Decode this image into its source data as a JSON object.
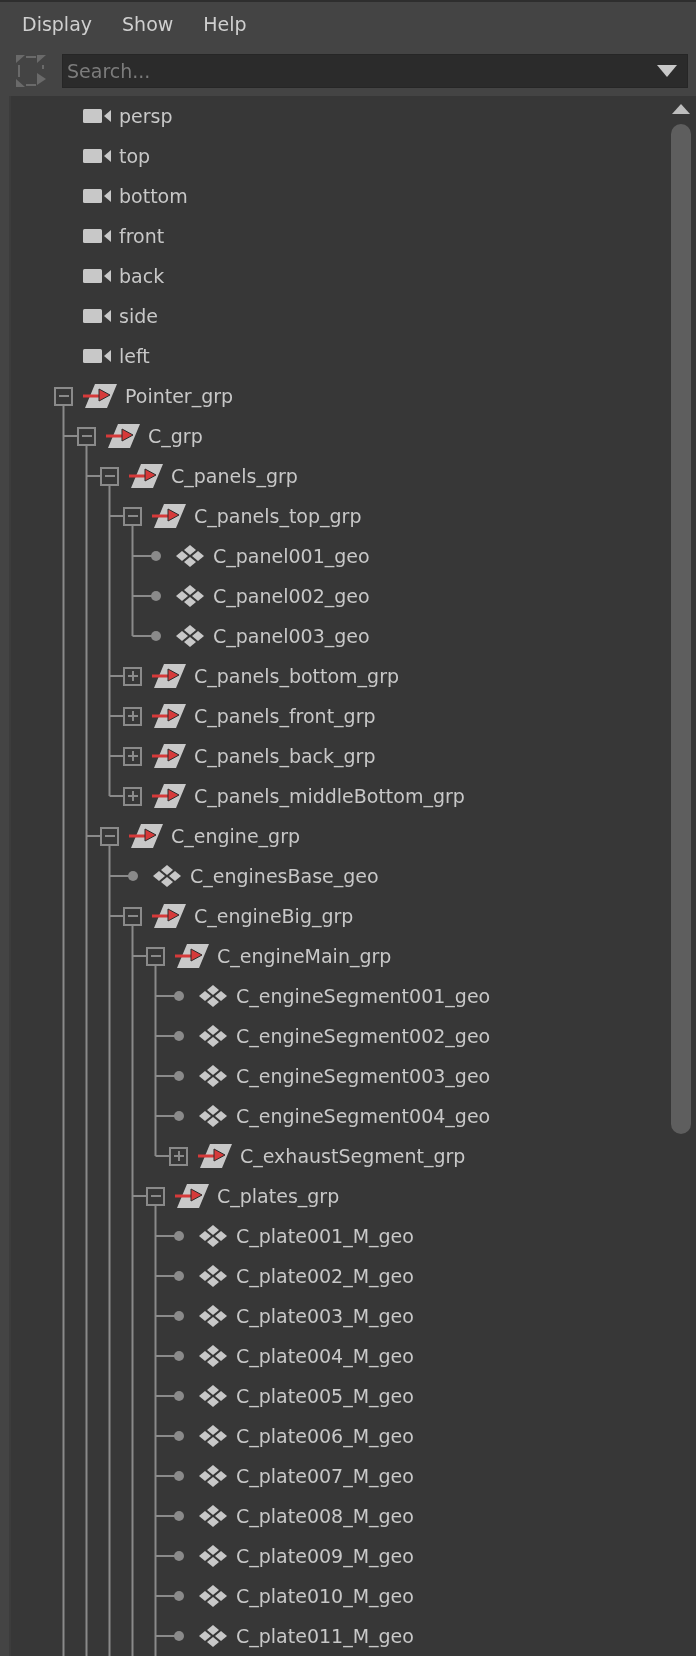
{
  "menu": [
    "Display",
    "Show",
    "Help"
  ],
  "search": {
    "placeholder": "Search..."
  },
  "tree": [
    {
      "label": "persp",
      "kind": "camera"
    },
    {
      "label": "top",
      "kind": "camera"
    },
    {
      "label": "bottom",
      "kind": "camera"
    },
    {
      "label": "front",
      "kind": "camera"
    },
    {
      "label": "back",
      "kind": "camera"
    },
    {
      "label": "side",
      "kind": "camera"
    },
    {
      "label": "left",
      "kind": "camera"
    },
    {
      "label": "Pointer_grp",
      "kind": "group",
      "expanded": true,
      "children": [
        {
          "label": "C_grp",
          "kind": "group",
          "expanded": true,
          "children": [
            {
              "label": "C_panels_grp",
              "kind": "group",
              "expanded": true,
              "children": [
                {
                  "label": "C_panels_top_grp",
                  "kind": "group",
                  "expanded": true,
                  "children": [
                    {
                      "label": "C_panel001_geo",
                      "kind": "mesh"
                    },
                    {
                      "label": "C_panel002_geo",
                      "kind": "mesh"
                    },
                    {
                      "label": "C_panel003_geo",
                      "kind": "mesh"
                    }
                  ]
                },
                {
                  "label": "C_panels_bottom_grp",
                  "kind": "group",
                  "expanded": false
                },
                {
                  "label": "C_panels_front_grp",
                  "kind": "group",
                  "expanded": false
                },
                {
                  "label": "C_panels_back_grp",
                  "kind": "group",
                  "expanded": false
                },
                {
                  "label": "C_panels_middleBottom_grp",
                  "kind": "group",
                  "expanded": false
                }
              ]
            },
            {
              "label": "C_engine_grp",
              "kind": "group",
              "expanded": true,
              "children": [
                {
                  "label": "C_enginesBase_geo",
                  "kind": "mesh"
                },
                {
                  "label": "C_engineBig_grp",
                  "kind": "group",
                  "expanded": true,
                  "children": [
                    {
                      "label": "C_engineMain_grp",
                      "kind": "group",
                      "expanded": true,
                      "children": [
                        {
                          "label": "C_engineSegment001_geo",
                          "kind": "mesh"
                        },
                        {
                          "label": "C_engineSegment002_geo",
                          "kind": "mesh"
                        },
                        {
                          "label": "C_engineSegment003_geo",
                          "kind": "mesh"
                        },
                        {
                          "label": "C_engineSegment004_geo",
                          "kind": "mesh"
                        },
                        {
                          "label": "C_exhaustSegment_grp",
                          "kind": "group",
                          "expanded": false
                        }
                      ]
                    },
                    {
                      "label": "C_plates_grp",
                      "kind": "group",
                      "expanded": true,
                      "children": [
                        {
                          "label": "C_plate001_M_geo",
                          "kind": "mesh"
                        },
                        {
                          "label": "C_plate002_M_geo",
                          "kind": "mesh"
                        },
                        {
                          "label": "C_plate003_M_geo",
                          "kind": "mesh"
                        },
                        {
                          "label": "C_plate004_M_geo",
                          "kind": "mesh"
                        },
                        {
                          "label": "C_plate005_M_geo",
                          "kind": "mesh"
                        },
                        {
                          "label": "C_plate006_M_geo",
                          "kind": "mesh"
                        },
                        {
                          "label": "C_plate007_M_geo",
                          "kind": "mesh"
                        },
                        {
                          "label": "C_plate008_M_geo",
                          "kind": "mesh"
                        },
                        {
                          "label": "C_plate009_M_geo",
                          "kind": "mesh"
                        },
                        {
                          "label": "C_plate010_M_geo",
                          "kind": "mesh"
                        },
                        {
                          "label": "C_plate011_M_geo",
                          "kind": "mesh"
                        }
                      ]
                    }
                  ]
                }
              ]
            }
          ]
        }
      ]
    }
  ]
}
